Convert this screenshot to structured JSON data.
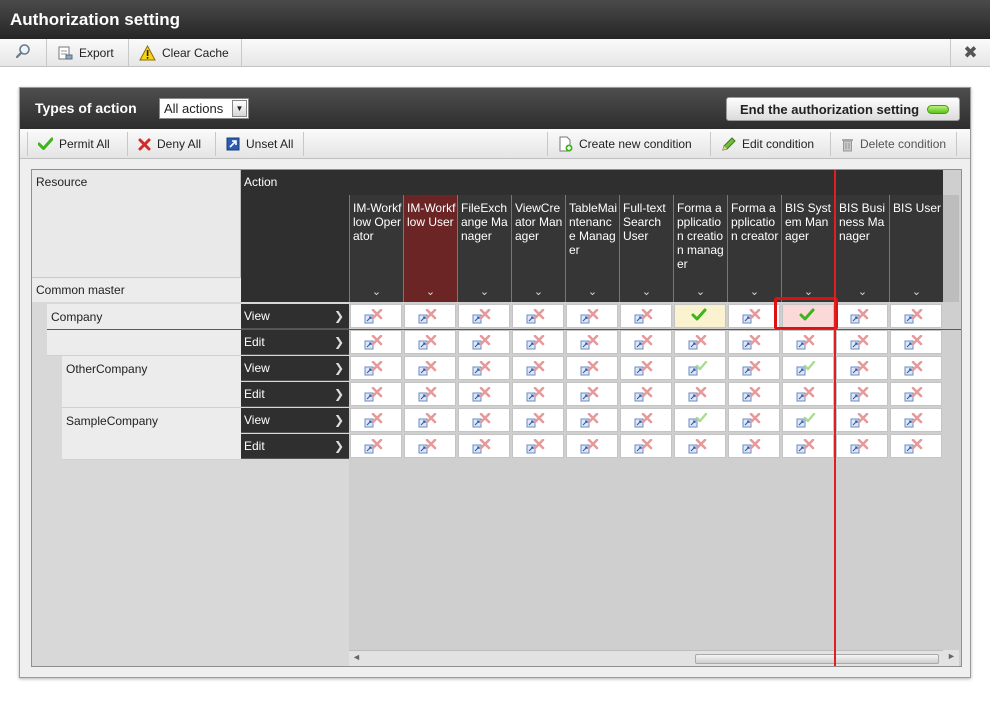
{
  "window": {
    "title": "Authorization setting",
    "close_icon": "close-icon"
  },
  "toolbar": {
    "search_icon": "magnifier-icon",
    "export_label": "Export",
    "clear_cache_label": "Clear Cache"
  },
  "panel": {
    "types_label": "Types of action",
    "types_select_value": "All actions",
    "end_button_label": "End the authorization setting",
    "end_button_led_color": "#6ad424"
  },
  "actions": {
    "permit_all": "Permit All",
    "deny_all": "Deny All",
    "unset_all": "Unset All",
    "create_condition": "Create new condition",
    "edit_condition": "Edit condition",
    "delete_condition": "Delete condition"
  },
  "grid": {
    "resource_header": "Resource",
    "action_header": "Action",
    "common_master": "Common master",
    "columns": [
      "IM-Workflow Operator",
      "IM-Workflow User",
      "FileExchange Manager",
      "ViewCreator Manager",
      "TableMaintenance Manager",
      "Full-text Search User",
      "Forma application creation manager",
      "Forma application creator",
      "BIS System Manager",
      "BIS Business Manager",
      "BIS User"
    ],
    "resources": [
      {
        "name": "Company",
        "rows": [
          {
            "action": "View",
            "states": [
              "unset",
              "unset",
              "unset",
              "unset",
              "unset",
              "unset",
              "permit",
              "unset",
              "permit",
              "unset",
              "unset"
            ]
          },
          {
            "action": "Edit",
            "states": [
              "unset",
              "unset",
              "unset",
              "unset",
              "unset",
              "unset",
              "unset",
              "unset",
              "unset",
              "unset",
              "unset"
            ]
          }
        ]
      },
      {
        "name": "OtherCompany",
        "rows": [
          {
            "action": "View",
            "states": [
              "unset",
              "unset",
              "unset",
              "unset",
              "unset",
              "unset",
              "inherit",
              "unset",
              "inherit",
              "unset",
              "unset"
            ]
          },
          {
            "action": "Edit",
            "states": [
              "unset",
              "unset",
              "unset",
              "unset",
              "unset",
              "unset",
              "unset",
              "unset",
              "unset",
              "unset",
              "unset"
            ]
          }
        ]
      },
      {
        "name": "SampleCompany",
        "rows": [
          {
            "action": "View",
            "states": [
              "unset",
              "unset",
              "unset",
              "unset",
              "unset",
              "unset",
              "inherit",
              "unset",
              "inherit",
              "unset",
              "unset"
            ]
          },
          {
            "action": "Edit",
            "states": [
              "unset",
              "unset",
              "unset",
              "unset",
              "unset",
              "unset",
              "unset",
              "unset",
              "unset",
              "unset",
              "unset"
            ]
          }
        ]
      }
    ]
  },
  "colors": {
    "header_dark": "#2f2f2f",
    "selected_column": "#6b2525",
    "highlight_red": "#e02020",
    "permit_green": "#3bb51a",
    "deny_red": "#e04848"
  }
}
